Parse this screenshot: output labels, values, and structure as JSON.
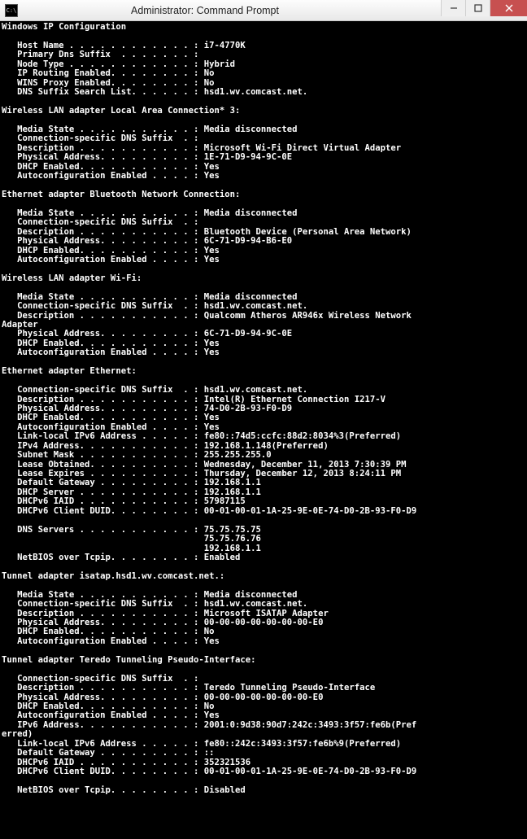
{
  "window": {
    "title": "Administrator: Command Prompt",
    "icon_label": "C:\\"
  },
  "output": {
    "header": "Windows IP Configuration",
    "host_name_label": "   Host Name . . . . . . . . . . . . : ",
    "host_name_value": "i7-4770K",
    "primary_dns_label": "   Primary Dns Suffix  . . . . . . . :",
    "primary_dns_value": "",
    "node_type_label": "   Node Type . . . . . . . . . . . . : ",
    "node_type_value": "Hybrid",
    "ip_routing_label": "   IP Routing Enabled. . . . . . . . : ",
    "ip_routing_value": "No",
    "wins_proxy_label": "   WINS Proxy Enabled. . . . . . . . : ",
    "wins_proxy_value": "No",
    "dns_suffix_list_label": "   DNS Suffix Search List. . . . . . : ",
    "dns_suffix_list_value": "hsd1.wv.comcast.net.",
    "wlan3_header": "Wireless LAN adapter Local Area Connection* 3:",
    "wlan3_media_label": "   Media State . . . . . . . . . . . : ",
    "wlan3_media_value": "Media disconnected",
    "wlan3_suffix_label": "   Connection-specific DNS Suffix  . :",
    "wlan3_suffix_value": "",
    "wlan3_desc_label": "   Description . . . . . . . . . . . : ",
    "wlan3_desc_value": "Microsoft Wi-Fi Direct Virtual Adapter",
    "wlan3_phys_label": "   Physical Address. . . . . . . . . : ",
    "wlan3_phys_value": "1E-71-D9-94-9C-0E",
    "wlan3_dhcp_label": "   DHCP Enabled. . . . . . . . . . . : ",
    "wlan3_dhcp_value": "Yes",
    "wlan3_auto_label": "   Autoconfiguration Enabled . . . . : ",
    "wlan3_auto_value": "Yes",
    "bt_header": "Ethernet adapter Bluetooth Network Connection:",
    "bt_media_label": "   Media State . . . . . . . . . . . : ",
    "bt_media_value": "Media disconnected",
    "bt_suffix_label": "   Connection-specific DNS Suffix  . :",
    "bt_suffix_value": "",
    "bt_desc_label": "   Description . . . . . . . . . . . : ",
    "bt_desc_value": "Bluetooth Device (Personal Area Network)",
    "bt_phys_label": "   Physical Address. . . . . . . . . : ",
    "bt_phys_value": "6C-71-D9-94-B6-E0",
    "bt_dhcp_label": "   DHCP Enabled. . . . . . . . . . . : ",
    "bt_dhcp_value": "Yes",
    "bt_auto_label": "   Autoconfiguration Enabled . . . . : ",
    "bt_auto_value": "Yes",
    "wifi_header": "Wireless LAN adapter Wi-Fi:",
    "wifi_media_label": "   Media State . . . . . . . . . . . : ",
    "wifi_media_value": "Media disconnected",
    "wifi_suffix_label": "   Connection-specific DNS Suffix  . : ",
    "wifi_suffix_value": "hsd1.wv.comcast.net.",
    "wifi_desc_label": "   Description . . . . . . . . . . . : ",
    "wifi_desc_value": "Qualcomm Atheros AR946x Wireless Network",
    "wifi_desc_cont": "Adapter",
    "wifi_phys_label": "   Physical Address. . . . . . . . . : ",
    "wifi_phys_value": "6C-71-D9-94-9C-0E",
    "wifi_dhcp_label": "   DHCP Enabled. . . . . . . . . . . : ",
    "wifi_dhcp_value": "Yes",
    "wifi_auto_label": "   Autoconfiguration Enabled . . . . : ",
    "wifi_auto_value": "Yes",
    "eth_header": "Ethernet adapter Ethernet:",
    "eth_suffix_label": "   Connection-specific DNS Suffix  . : ",
    "eth_suffix_value": "hsd1.wv.comcast.net.",
    "eth_desc_label": "   Description . . . . . . . . . . . : ",
    "eth_desc_value": "Intel(R) Ethernet Connection I217-V",
    "eth_phys_label": "   Physical Address. . . . . . . . . : ",
    "eth_phys_value": "74-D0-2B-93-F0-D9",
    "eth_dhcp_label": "   DHCP Enabled. . . . . . . . . . . : ",
    "eth_dhcp_value": "Yes",
    "eth_auto_label": "   Autoconfiguration Enabled . . . . : ",
    "eth_auto_value": "Yes",
    "eth_ll6_label": "   Link-local IPv6 Address . . . . . : ",
    "eth_ll6_value": "fe80::74d5:ccfc:88d2:8034%3(Preferred)",
    "eth_ipv4_label": "   IPv4 Address. . . . . . . . . . . : ",
    "eth_ipv4_value": "192.168.1.148(Preferred)",
    "eth_mask_label": "   Subnet Mask . . . . . . . . . . . : ",
    "eth_mask_value": "255.255.255.0",
    "eth_lobt_label": "   Lease Obtained. . . . . . . . . . : ",
    "eth_lobt_value": "Wednesday, December 11, 2013 7:30:39 PM",
    "eth_lexp_label": "   Lease Expires . . . . . . . . . . : ",
    "eth_lexp_value": "Thursday, December 12, 2013 8:24:11 PM",
    "eth_gw_label": "   Default Gateway . . . . . . . . . : ",
    "eth_gw_value": "192.168.1.1",
    "eth_dhcpsrv_label": "   DHCP Server . . . . . . . . . . . : ",
    "eth_dhcpsrv_value": "192.168.1.1",
    "eth_iaid_label": "   DHCPv6 IAID . . . . . . . . . . . : ",
    "eth_iaid_value": "57987115",
    "eth_duid_label": "   DHCPv6 Client DUID. . . . . . . . : ",
    "eth_duid_value": "00-01-00-01-1A-25-9E-0E-74-D0-2B-93-F0-D9",
    "eth_dns_label": "   DNS Servers . . . . . . . . . . . : ",
    "eth_dns1": "75.75.75.75",
    "eth_dns2_pad": "                                       ",
    "eth_dns2": "75.75.76.76",
    "eth_dns3_pad": "                                       ",
    "eth_dns3": "192.168.1.1",
    "eth_nbt_label": "   NetBIOS over Tcpip. . . . . . . . : ",
    "eth_nbt_value": "Enabled",
    "isatap_header": "Tunnel adapter isatap.hsd1.wv.comcast.net.:",
    "isa_media_label": "   Media State . . . . . . . . . . . : ",
    "isa_media_value": "Media disconnected",
    "isa_suffix_label": "   Connection-specific DNS Suffix  . : ",
    "isa_suffix_value": "hsd1.wv.comcast.net.",
    "isa_desc_label": "   Description . . . . . . . . . . . : ",
    "isa_desc_value": "Microsoft ISATAP Adapter",
    "isa_phys_label": "   Physical Address. . . . . . . . . : ",
    "isa_phys_value": "00-00-00-00-00-00-00-E0",
    "isa_dhcp_label": "   DHCP Enabled. . . . . . . . . . . : ",
    "isa_dhcp_value": "No",
    "isa_auto_label": "   Autoconfiguration Enabled . . . . : ",
    "isa_auto_value": "Yes",
    "teredo_header": "Tunnel adapter Teredo Tunneling Pseudo-Interface:",
    "ter_suffix_label": "   Connection-specific DNS Suffix  . :",
    "ter_suffix_value": "",
    "ter_desc_label": "   Description . . . . . . . . . . . : ",
    "ter_desc_value": "Teredo Tunneling Pseudo-Interface",
    "ter_phys_label": "   Physical Address. . . . . . . . . : ",
    "ter_phys_value": "00-00-00-00-00-00-00-E0",
    "ter_dhcp_label": "   DHCP Enabled. . . . . . . . . . . : ",
    "ter_dhcp_value": "No",
    "ter_auto_label": "   Autoconfiguration Enabled . . . . : ",
    "ter_auto_value": "Yes",
    "ter_ipv6_label": "   IPv6 Address. . . . . . . . . . . : ",
    "ter_ipv6_value": "2001:0:9d38:90d7:242c:3493:3f57:fe6b(Pref",
    "ter_ipv6_cont": "erred)",
    "ter_ll6_label": "   Link-local IPv6 Address . . . . . : ",
    "ter_ll6_value": "fe80::242c:3493:3f57:fe6b%9(Preferred)",
    "ter_gw_label": "   Default Gateway . . . . . . . . . : ",
    "ter_gw_value": "::",
    "ter_iaid_label": "   DHCPv6 IAID . . . . . . . . . . . : ",
    "ter_iaid_value": "352321536",
    "ter_duid_label": "   DHCPv6 Client DUID. . . . . . . . : ",
    "ter_duid_value": "00-01-00-01-1A-25-9E-0E-74-D0-2B-93-F0-D9",
    "ter_nbt_label": "   NetBIOS over Tcpip. . . . . . . . : ",
    "ter_nbt_value": "Disabled"
  }
}
